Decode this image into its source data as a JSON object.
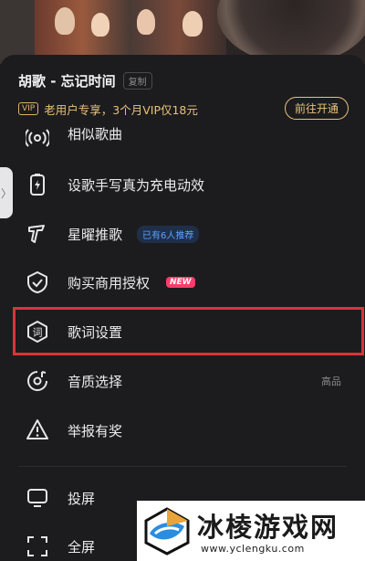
{
  "song": {
    "title": "胡歌 - 忘记时间",
    "copy_label": "复制"
  },
  "vip": {
    "tag": "VIP",
    "promo_text": "老用户专享，3个月VIP仅18元",
    "button_label": "前往开通"
  },
  "menu": [
    {
      "label": "相似歌曲",
      "icon": "radio-waves-icon"
    },
    {
      "label": "设歌手写真为充电动效",
      "icon": "battery-charge-icon"
    },
    {
      "label": "星曜推歌",
      "icon": "star-recommend-icon",
      "badge": "已有6人推荐"
    },
    {
      "label": "购买商用授权",
      "icon": "shield-check-icon",
      "badge": "NEW"
    },
    {
      "label": "歌词设置",
      "icon": "lyrics-icon",
      "glyph": "词"
    },
    {
      "label": "音质选择",
      "icon": "audio-quality-icon",
      "right": "高品"
    },
    {
      "label": "举报有奖",
      "icon": "warning-icon"
    },
    {
      "label": "投屏",
      "icon": "cast-screen-icon"
    },
    {
      "label": "全屏",
      "icon": "fullscreen-icon"
    }
  ],
  "side_handle": "〉",
  "watermark": {
    "title": "冰棱游戏网",
    "url": "www.yclengku.com"
  }
}
